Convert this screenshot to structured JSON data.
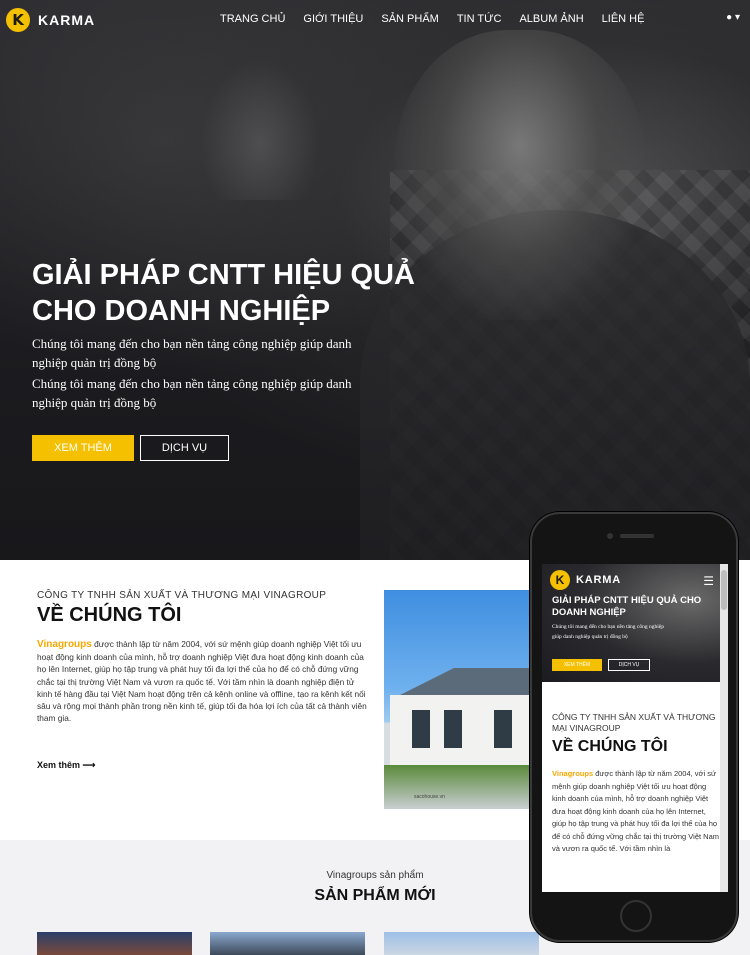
{
  "brand": {
    "logo_letter": "K",
    "name": "KARMA"
  },
  "nav": {
    "items": [
      "TRANG CHỦ",
      "GIỚI THIỆU",
      "SẢN PHẨM",
      "TIN TỨC",
      "ALBUM ẢNH",
      "LIÊN HỆ"
    ],
    "user_icon": "user-icon",
    "user_label": "▾"
  },
  "hero": {
    "title_line1": "GIẢI PHÁP CNTT HIỆU QUẢ",
    "title_line2": "CHO DOANH NGHIỆP",
    "text_1": "Chúng tôi mang đến cho bạn nền tảng công nghiệp giúp danh nghiệp quản trị đồng bộ",
    "text_2": "Chúng tôi mang đến cho bạn nền tảng công nghiệp giúp danh nghiệp quản trị đồng bộ",
    "button_more": "XEM THÊM",
    "button_service": "DỊCH VỤ"
  },
  "about": {
    "company": "CÔNG TY TNHH SẢN XUẤT VÀ THƯƠNG MẠI VINAGROUP",
    "heading": "VỀ CHÚNG TÔI",
    "brand_word": "Vinagroups",
    "paragraph": " được thành lập từ năm 2004, với sứ mệnh giúp doanh nghiệp Việt tối ưu hoạt động kinh doanh của mình, hỗ trợ doanh nghiệp Việt đưa hoạt động kinh doanh của họ lên Internet, giúp họ tập trung và phát huy tối đa lợi thế của họ để có chỗ đứng vững chắc tại thị trường Việt Nam và vươn ra quốc tế. Với tầm nhìn là doanh nghiệp điện tử kinh tế hàng đầu tại Việt Nam hoạt động trên cả kênh online và offline, tạo ra kênh kết nối sâu và rộng mọi thành phần trong nền kinh tế, giúp tối đa hóa lợi ích của tất cả thành viên tham gia.",
    "read_more": "Xem thêm ⟶",
    "image_caption": "sacohouse.vn"
  },
  "products": {
    "subtitle": "Vinagroups sản phẩm",
    "heading": "SẢN PHẨM MỚI"
  },
  "mobile": {
    "logo_letter": "K",
    "name": "KARMA",
    "menu_icon": "☰",
    "title": "GIẢI PHÁP CNTT HIỆU QUẢ CHO DOANH NGHIỆP",
    "text": "Chúng tôi mang đến cho bạn nền tảng công nghiệp giúp danh nghiệp quản trị đồng bộ",
    "button_more": "XEM THÊM",
    "button_service": "DỊCH VỤ",
    "company": "CÔNG TY TNHH SẢN XUẤT VÀ THƯƠNG MẠI VINAGROUP",
    "heading": "VỀ CHÚNG TÔI",
    "brand_word": "Vinagroups",
    "paragraph": " được thành lập từ năm 2004, với sứ mệnh giúp doanh nghiệp Việt tối ưu hoạt động kinh doanh của mình, hỗ trợ doanh nghiệp Việt đưa hoạt động kinh doanh của họ lên Internet, giúp họ tập trung và phát huy tối đa lợi thế của họ để có chỗ đứng vững chắc tại thị trường Việt Nam và vươn ra quốc tế. Với tầm nhìn là"
  },
  "colors": {
    "accent": "#f5c000",
    "dark": "#1c1c20"
  }
}
